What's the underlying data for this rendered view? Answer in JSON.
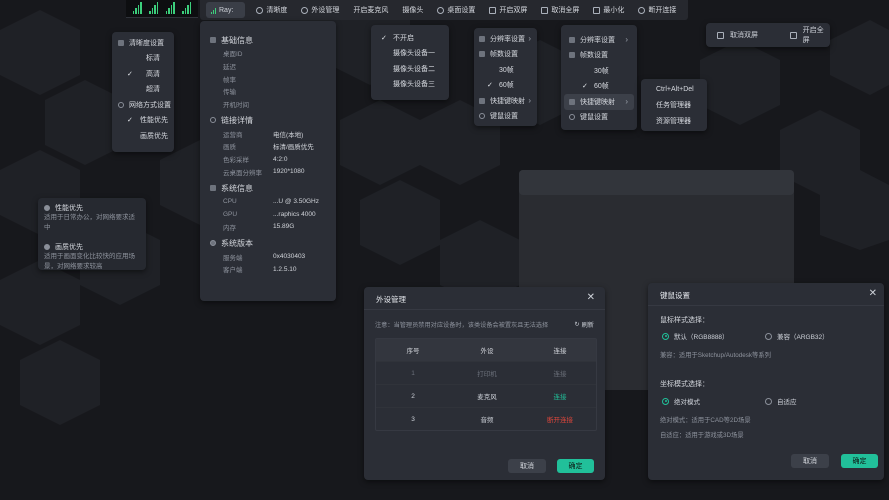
{
  "toolbar": {
    "ray_label": "Ray:",
    "items": [
      "清晰度",
      "外设管理",
      "开启麦克风",
      "摄像头",
      "桌面设置",
      "开启双屏",
      "取消全屏",
      "最小化",
      "断开连接"
    ]
  },
  "quality_menu": {
    "title": "清晰度设置",
    "options": [
      "标清",
      "高清",
      "超清"
    ],
    "selected": "高清",
    "network_title": "网络方式设置",
    "network_options": [
      "性能优先",
      "画质优先"
    ],
    "network_selected": "性能优先"
  },
  "tooltip": {
    "perf_title": "性能优先",
    "perf_desc": "适用于日常办公，对网络要求适中",
    "quality_title": "画质优先",
    "quality_desc": "适用于画面变化比较快的应用场景，对网络要求较高"
  },
  "info_panel": {
    "basic_title": "基础信息",
    "basic_rows": [
      "桌面ID",
      "延迟",
      "帧率",
      "传输",
      "开机时间"
    ],
    "link_title": "链接详情",
    "link_rows": [
      {
        "k": "运营商",
        "v": "电信(本地)"
      },
      {
        "k": "画质",
        "v": "标清/画质优先"
      },
      {
        "k": "色彩采样",
        "v": "4:2:0"
      },
      {
        "k": "云桌面分辨率",
        "v": "1920*1080"
      }
    ],
    "sys_title": "系统信息",
    "sys_rows": [
      {
        "k": "CPU",
        "v": "...U @ 3.50GHz"
      },
      {
        "k": "GPU",
        "v": "...raphics 4000"
      },
      {
        "k": "内存",
        "v": "15.89G"
      }
    ],
    "ver_title": "系统版本",
    "ver_rows": [
      {
        "k": "服务端",
        "v": "0x4030403"
      },
      {
        "k": "客户端",
        "v": "1.2.5.10"
      }
    ]
  },
  "camera_menu": {
    "options": [
      "不开启",
      "摄像头设备一",
      "摄像头设备二",
      "摄像头设备三"
    ],
    "selected": "不开启"
  },
  "desktop_menu_a": {
    "resolution": "分辨率设置",
    "fps": "帧数设置",
    "fps_options": [
      "30帧",
      "60帧"
    ],
    "fps_selected": "60帧",
    "shortcut": "快捷键映射",
    "keymouse": "键鼠设置"
  },
  "desktop_menu_b": {
    "resolution": "分辨率设置",
    "fps": "帧数设置",
    "fps_options": [
      "30帧",
      "60帧"
    ],
    "fps_selected": "60帧",
    "shortcut": "快捷键映射",
    "keymouse": "键鼠设置"
  },
  "shortcut_submenu": [
    "Ctrl+Alt+Del",
    "任务管理器",
    "资源管理器"
  ],
  "dual_screen": {
    "cancel": "取消双屏",
    "fullscreen": "开启全屏"
  },
  "peripheral_dialog": {
    "title": "外设管理",
    "notice": "注意：当管理员禁用对应设备时，该类设备会被置灰且无法选择",
    "refresh": "刷新",
    "headers": [
      "序号",
      "外设",
      "连接"
    ],
    "rows": [
      {
        "no": "1",
        "device": "打印机",
        "status": "连接",
        "state": "disabled"
      },
      {
        "no": "2",
        "device": "麦克风",
        "status": "连接",
        "state": "connected"
      },
      {
        "no": "3",
        "device": "音频",
        "status": "断开连接",
        "state": "disconnect"
      }
    ],
    "cancel": "取消",
    "confirm": "确定"
  },
  "keymouse_dialog": {
    "title": "键鼠设置",
    "coord_style_title": "鼠标样式选择：",
    "opt_default": "默认（RGB8888）",
    "opt_compat": "兼容（ARGB32）",
    "compat_note": "兼容：适用于Sketchup/Autodesk等系列",
    "coord_mode_title": "坐标模式选择：",
    "opt_absolute": "绝对模式",
    "opt_adaptive": "自适应",
    "absolute_note": "绝对模式：适用于CAD等2D场景",
    "adaptive_note": "自适应：适用于游戏或3D场景",
    "cancel": "取消",
    "confirm": "确定"
  },
  "colors": {
    "accent": "#21c09a",
    "danger": "#e0473c",
    "signal": "#3ccf7c"
  }
}
